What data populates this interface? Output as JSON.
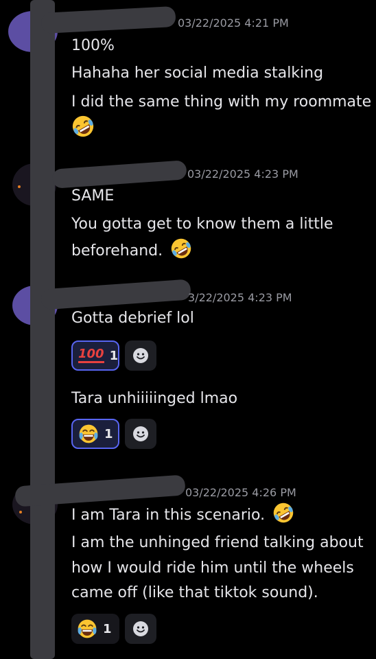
{
  "messages": [
    {
      "timestamp": "03/22/2025 4:21 PM",
      "lines": [
        "100%",
        "Hahaha her social media stalking",
        "I did the same thing with my roommate"
      ],
      "trailing_emoji": "rolling-on-floor-laughing"
    },
    {
      "timestamp": "03/22/2025 4:23 PM",
      "lines": [
        "SAME",
        "You gotta get to know them a little",
        "beforehand."
      ],
      "inline_emoji": "rolling-on-floor-laughing"
    },
    {
      "timestamp": "3/22/2025 4:23 PM",
      "lines": [
        "Gotta debrief lol"
      ],
      "reaction": {
        "emoji": "hundred-points",
        "badge_text": "100",
        "count": "1"
      },
      "followup": {
        "text": "Tara unhiiiiinged lmao",
        "reaction": {
          "emoji": "face-with-tears-of-joy",
          "count": "1"
        }
      }
    },
    {
      "timestamp": "03/22/2025 4:26 PM",
      "lines": [
        "I am Tara in this scenario.",
        "I am the unhinged friend talking about",
        "how I would ride him until the wheels",
        "came off (like that tiktok sound)."
      ],
      "inline_emoji": "rolling-on-floor-laughing",
      "reaction": {
        "emoji": "face-with-tears-of-joy",
        "count": "1"
      }
    }
  ],
  "colors": {
    "background": "#000000",
    "text": "#e6e6ea",
    "timestamp": "#9a9ba3",
    "reaction_active_border": "#5865f2",
    "redaction": "#3b3b40",
    "avatar_purple": "#5c4ea3"
  },
  "icons": {
    "add_reaction": "smiley-add-reaction-icon"
  }
}
